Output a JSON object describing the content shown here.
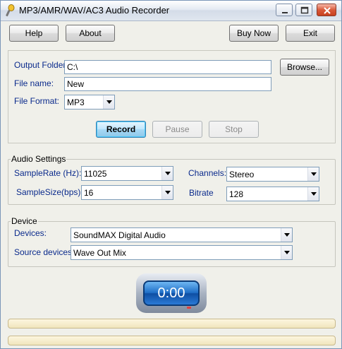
{
  "window": {
    "title": "MP3/AMR/WAV/AC3 Audio Recorder"
  },
  "toolbar": {
    "help": "Help",
    "about": "About",
    "buy_now": "Buy Now",
    "exit": "Exit"
  },
  "output": {
    "folder_label": "Output Folder:",
    "folder_value": "C:\\",
    "browse": "Browse...",
    "filename_label": "File name:",
    "filename_value": "New",
    "format_label": "File Format:",
    "format_value": "MP3"
  },
  "controls": {
    "record": "Record",
    "pause": "Pause",
    "stop": "Stop"
  },
  "audio": {
    "group_title": "Audio Settings",
    "samplerate_label": "SampleRate (Hz):",
    "samplerate_value": "11025",
    "samplesize_label": "SampleSize(bps):",
    "samplesize_value": "16",
    "channels_label": "Channels:",
    "channels_value": "Stereo",
    "bitrate_label": "Bitrate",
    "bitrate_value": "128"
  },
  "device": {
    "group_title": "Device",
    "devices_label": "Devices:",
    "devices_value": "SoundMAX Digital Audio",
    "source_label": "Source devices:",
    "source_value": "Wave Out Mix"
  },
  "timer": {
    "display": "0:00"
  },
  "progress": {
    "bar1": 0,
    "bar2": 0
  },
  "colors": {
    "record_button_border": "#3c7fb1",
    "timer_face": "#1f6fc7",
    "label_text": "#0a2a8c"
  },
  "icons": {
    "app": "microphone-icon",
    "minimize": "minimize-icon",
    "maximize": "maximize-icon",
    "close": "close-icon"
  }
}
